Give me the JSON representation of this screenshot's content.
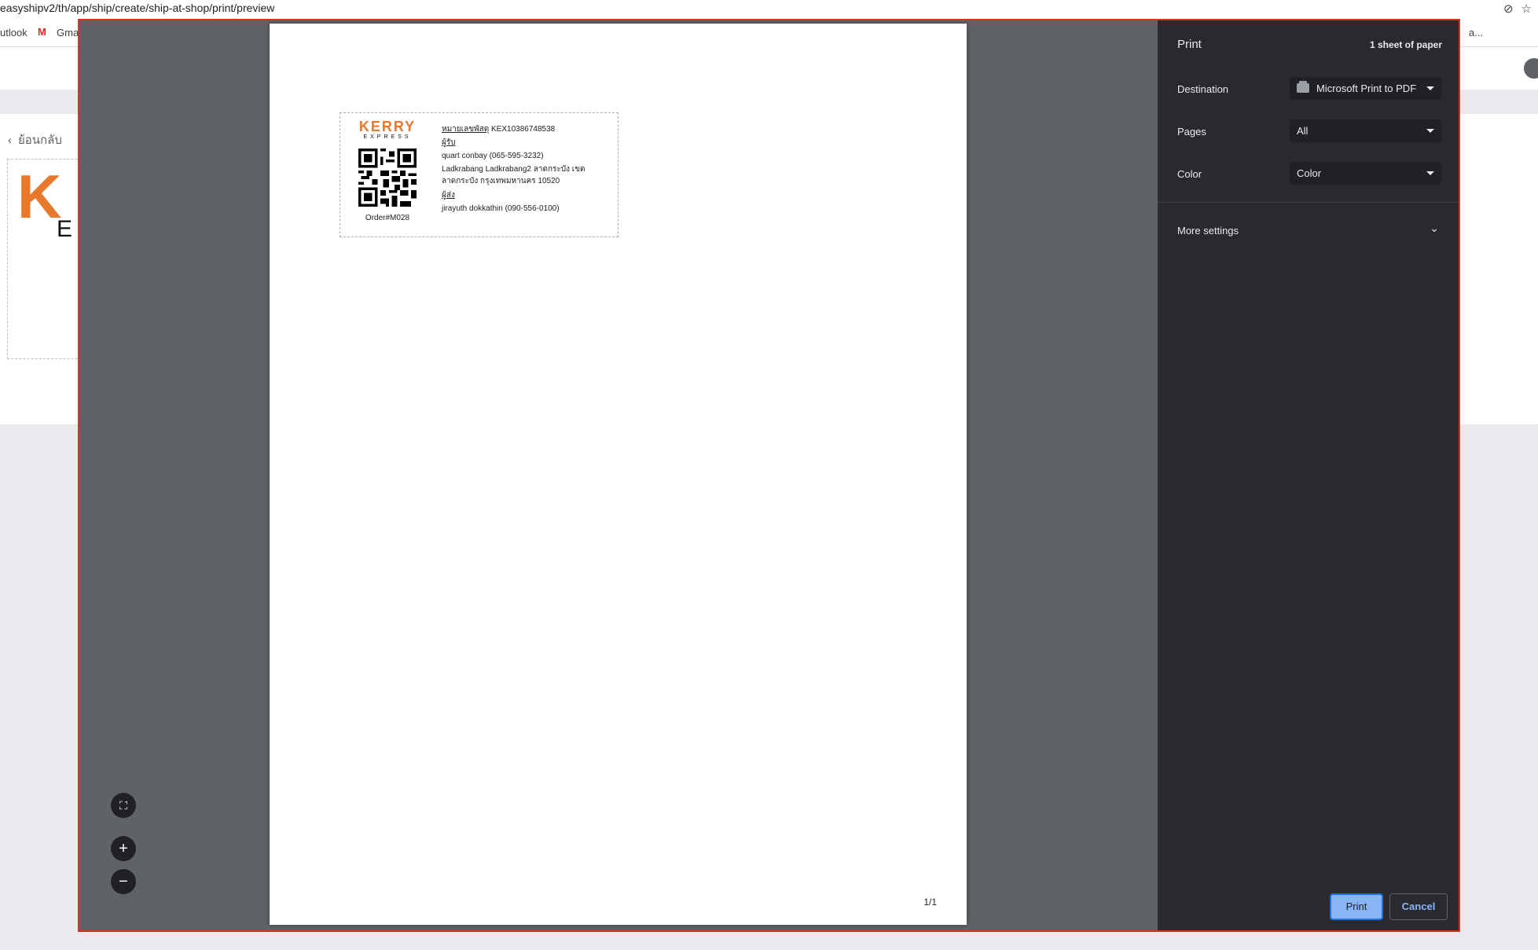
{
  "browser": {
    "url": "easyshipv2/th/app/ship/create/ship-at-shop/print/preview",
    "bookmarks": [
      {
        "label": "utlook"
      },
      {
        "label": "Gmai"
      }
    ],
    "bookmark_overflow": "a..."
  },
  "app": {
    "back_label": "ย้อนกลับ",
    "bg_logo": "K",
    "bg_logo_sub": "E"
  },
  "print_dialog": {
    "title": "Print",
    "sheets": "1 sheet of paper",
    "destination_label": "Destination",
    "destination_value": "Microsoft Print to PDF",
    "pages_label": "Pages",
    "pages_value": "All",
    "color_label": "Color",
    "color_value": "Color",
    "more_settings_label": "More settings",
    "print_button": "Print",
    "cancel_button": "Cancel",
    "page_indicator": "1/1"
  },
  "shipping_label": {
    "logo_text": "KERRY",
    "logo_sub": "EXPRESS",
    "order_no": "Order#M028",
    "tracking_label": "หมายเลขพัสดุ",
    "tracking_no": "KEX10386748538",
    "receiver_label": "ผู้รับ",
    "receiver": "quart conbay (065-595-3232)",
    "address_line1": "Ladkrabang Ladkrabang2 ลาดกระบัง เขต",
    "address_line2": "ลาดกระบัง กรุงเทพมหานคร 10520",
    "sender_label": "ผู้ส่ง",
    "sender": "jirayuth dokkathin (090-556-0100)"
  },
  "colors": {
    "accent": "#8ab4f8",
    "kerry_orange": "#e8782c",
    "dialog_border": "#d93025"
  }
}
